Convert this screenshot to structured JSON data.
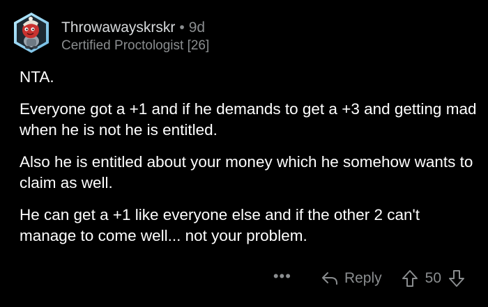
{
  "comment": {
    "author": "Throwawayskrskr",
    "separator": "•",
    "age": "9d",
    "flair": "Certified Proctologist [26]",
    "paragraphs": [
      "NTA.",
      "Everyone got a +1 and if he demands to get a +3 and getting mad when he is not he is entitled.",
      "Also he is entitled about your money which he somehow wants to claim as well.",
      "He can get a +1 like everyone else and if the other 2 can't manage to come well... not your problem."
    ],
    "actions": {
      "more": "•••",
      "reply_label": "Reply",
      "score": "50"
    }
  },
  "colors": {
    "background": "#000000",
    "text": "#ffffff",
    "muted": "#8a8d8f",
    "avatar_ring": "#8fd3f2",
    "avatar_body": "#c8322f"
  },
  "icons": {
    "avatar": "snoo-avatar",
    "reply": "reply-arrow-icon",
    "upvote": "upvote-arrow-icon",
    "downvote": "downvote-arrow-icon"
  }
}
